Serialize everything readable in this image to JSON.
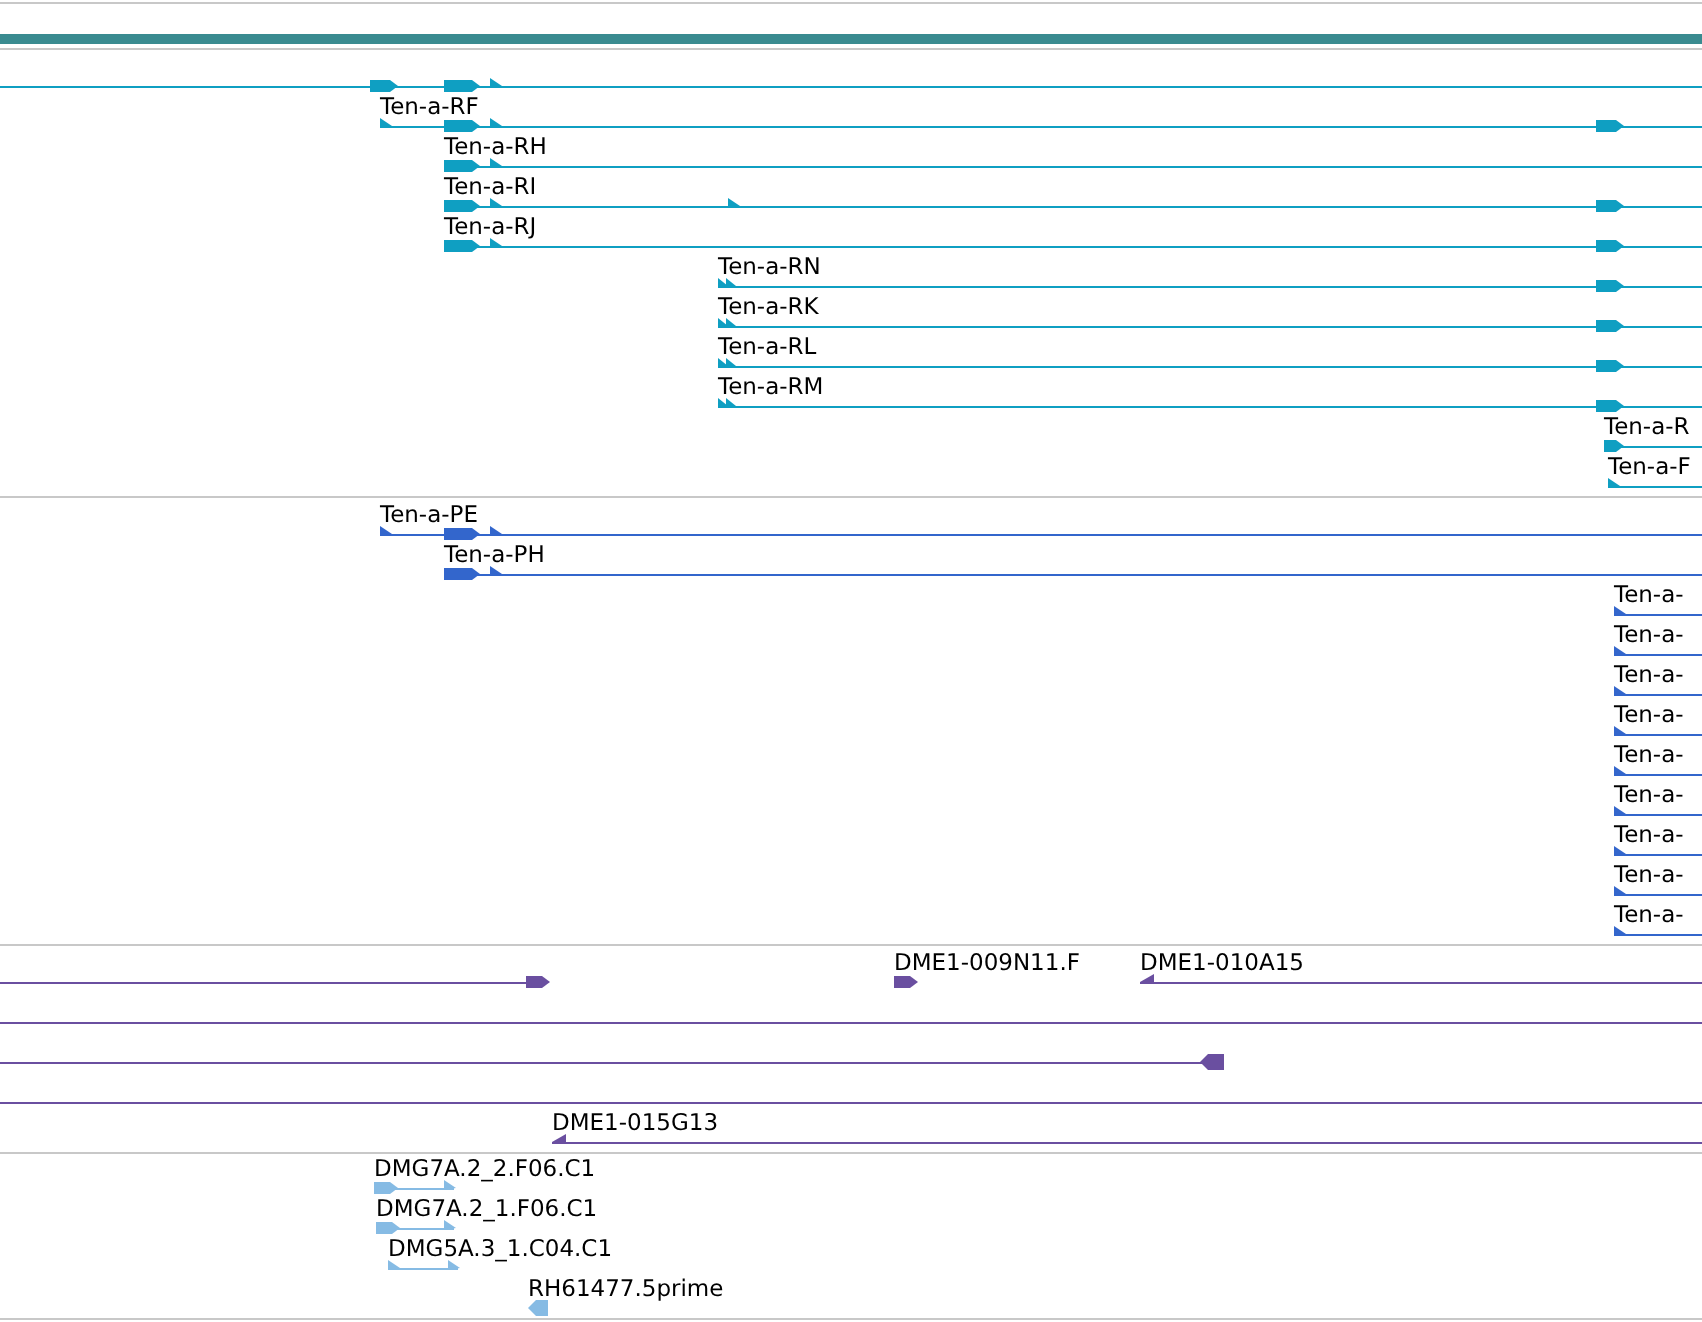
{
  "tracks": [
    {
      "color": "#0f9fc2",
      "rows": [
        {},
        {
          "labels": [
            "Ten-a-RF"
          ]
        },
        {
          "labels": [
            "Ten-a-RH"
          ]
        },
        {
          "labels": [
            "Ten-a-RI"
          ]
        },
        {
          "labels": [
            "Ten-a-RJ"
          ]
        },
        {
          "labels": [
            "Ten-a-RN"
          ]
        },
        {
          "labels": [
            "Ten-a-RK"
          ]
        },
        {
          "labels": [
            "Ten-a-RL"
          ]
        },
        {
          "labels": [
            "Ten-a-RM"
          ]
        },
        {
          "labels": [
            "Ten-a-R"
          ]
        },
        {
          "labels": [
            "Ten-a-F"
          ]
        }
      ]
    },
    {
      "color": "#3366cc",
      "rows": [
        {
          "labels": [
            "Ten-a-PE"
          ]
        },
        {
          "labels": [
            "Ten-a-PH"
          ]
        },
        {
          "labels": [
            "Ten-a-"
          ]
        },
        {
          "labels": [
            "Ten-a-"
          ]
        },
        {
          "labels": [
            "Ten-a-"
          ]
        },
        {
          "labels": [
            "Ten-a-"
          ]
        },
        {
          "labels": [
            "Ten-a-"
          ]
        },
        {
          "labels": [
            "Ten-a-"
          ]
        },
        {
          "labels": [
            "Ten-a-"
          ]
        },
        {
          "labels": [
            "Ten-a-"
          ]
        },
        {
          "labels": [
            "Ten-a-"
          ]
        }
      ]
    },
    {
      "color": "#6a4fa0",
      "rows": [
        {
          "labels": [
            "DME1-009N11.F",
            "DME1-010A15"
          ]
        },
        {},
        {},
        {},
        {
          "labels": [
            "DME1-015G13"
          ]
        }
      ]
    },
    {
      "color": "#86bbe4",
      "rows": [
        {
          "labels": [
            "DMG7A.2_2.F06.C1"
          ]
        },
        {
          "labels": [
            "DMG7A.2_1.F06.C1"
          ]
        },
        {
          "labels": [
            "DMG5A.3_1.C04.C1"
          ]
        },
        {
          "labels": [
            "RH61477.5prime"
          ]
        }
      ]
    }
  ]
}
